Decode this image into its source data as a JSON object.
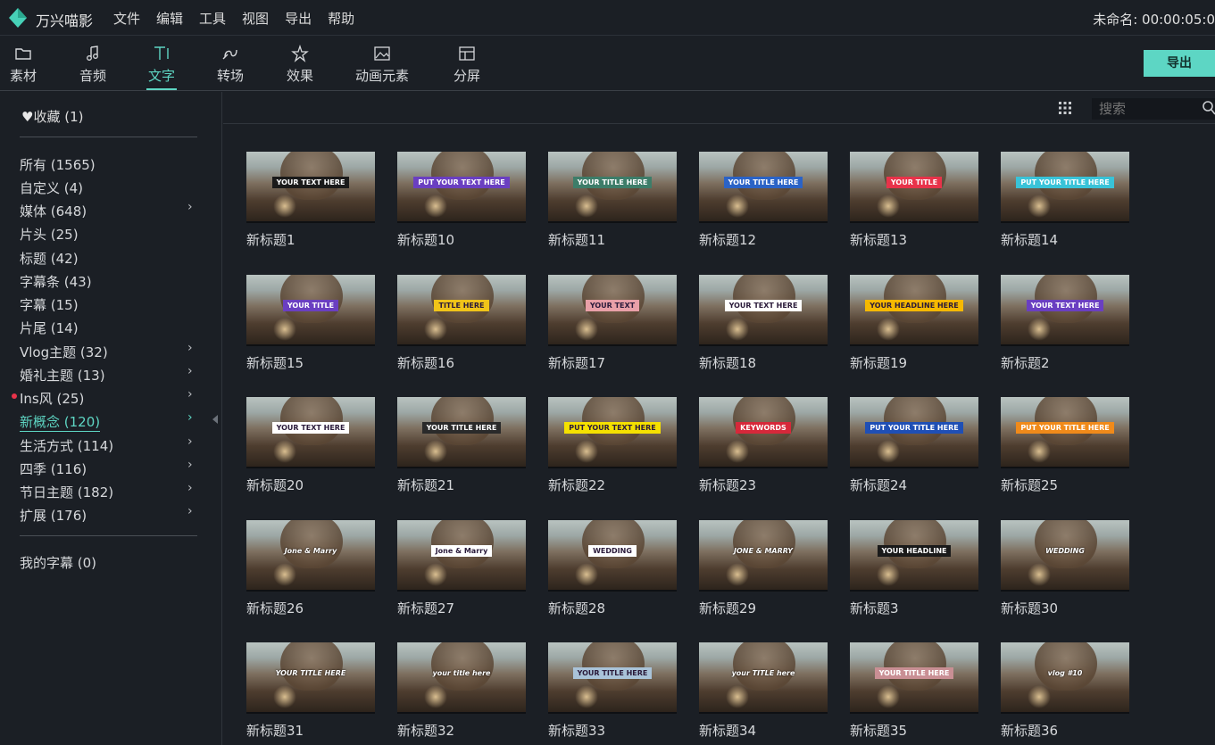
{
  "app": {
    "title": "万兴喵影",
    "project": "未命名: 00:00:05:0",
    "menu": [
      "文件",
      "编辑",
      "工具",
      "视图",
      "导出",
      "帮助"
    ]
  },
  "tabs": [
    {
      "label": "素材",
      "icon": "folder-icon"
    },
    {
      "label": "音频",
      "icon": "music-note-icon"
    },
    {
      "label": "文字",
      "icon": "text-icon",
      "active": true
    },
    {
      "label": "转场",
      "icon": "transition-icon"
    },
    {
      "label": "效果",
      "icon": "effects-icon"
    },
    {
      "label": "动画元素",
      "icon": "image-icon"
    },
    {
      "label": "分屏",
      "icon": "split-screen-icon"
    }
  ],
  "export_label": "导出",
  "sidebar": {
    "favorites": "收藏 (1)",
    "categories": [
      {
        "label": "所有 (1565)",
        "arrow": false
      },
      {
        "label": "自定义 (4)",
        "arrow": false
      },
      {
        "label": "媒体 (648)",
        "arrow": true
      },
      {
        "label": "片头 (25)",
        "arrow": false
      },
      {
        "label": "标题 (42)",
        "arrow": false
      },
      {
        "label": "字幕条 (43)",
        "arrow": false
      },
      {
        "label": "字幕 (15)",
        "arrow": false
      },
      {
        "label": "片尾 (14)",
        "arrow": false
      },
      {
        "label": "Vlog主题 (32)",
        "arrow": true
      },
      {
        "label": "婚礼主题 (13)",
        "arrow": true
      },
      {
        "label": "Ins风 (25)",
        "arrow": true,
        "dot": true
      },
      {
        "label": "新概念 (120)",
        "arrow": true,
        "active": true
      },
      {
        "label": "生活方式 (114)",
        "arrow": true
      },
      {
        "label": "四季 (116)",
        "arrow": true
      },
      {
        "label": "节日主题 (182)",
        "arrow": true
      },
      {
        "label": "扩展 (176)",
        "arrow": true
      }
    ],
    "my_subtitles": "我的字幕 (0)"
  },
  "search": {
    "placeholder": "搜索"
  },
  "colors": {
    "accent": "#5ed6c3",
    "export_bg": "#5dd6c4",
    "background": "#1b1f25"
  },
  "templates": [
    {
      "name": "新标题1",
      "overlay": "YOUR TEXT HERE",
      "color": "#1a1a1a"
    },
    {
      "name": "新标题10",
      "overlay": "PUT YOUR TEXT HERE",
      "color": "#6a3fc1"
    },
    {
      "name": "新标题11",
      "overlay": "YOUR TITLE HERE",
      "color": "#3d7d69"
    },
    {
      "name": "新标题12",
      "overlay": "YOUR TITLE HERE",
      "color": "#2b63c6"
    },
    {
      "name": "新标题13",
      "overlay": "YOUR TITLE",
      "color": "#e8334a"
    },
    {
      "name": "新标题14",
      "overlay": "PUT YOUR TITLE HERE",
      "color": "#39c3d8"
    },
    {
      "name": "新标题15",
      "overlay": "YOUR TITLE",
      "color": "#6a3fc1"
    },
    {
      "name": "新标题16",
      "overlay": "TITLE HERE",
      "color": "#f0c419"
    },
    {
      "name": "新标题17",
      "overlay": "YOUR TEXT",
      "color": "#e9a0a8"
    },
    {
      "name": "新标题18",
      "overlay": "YOUR TEXT HERE",
      "color": "#ffffff"
    },
    {
      "name": "新标题19",
      "overlay": "YOUR HEADLINE HERE",
      "color": "#f5b800"
    },
    {
      "name": "新标题2",
      "overlay": "YOUR TEXT HERE",
      "color": "#6a3fc1"
    },
    {
      "name": "新标题20",
      "overlay": "YOUR TEXT HERE",
      "color": "#ffffff"
    },
    {
      "name": "新标题21",
      "overlay": "YOUR TITLE HERE",
      "color": "#2a2a2a"
    },
    {
      "name": "新标题22",
      "overlay": "PUT YOUR TEXT HERE",
      "color": "#f5e100"
    },
    {
      "name": "新标题23",
      "overlay": "KEYWORDS",
      "color": "#d6283a"
    },
    {
      "name": "新标题24",
      "overlay": "PUT YOUR TITLE HERE",
      "color": "#1f4fb5"
    },
    {
      "name": "新标题25",
      "overlay": "PUT YOUR TITLE HERE",
      "color": "#f08a1a"
    },
    {
      "name": "新标题26",
      "overlay": "Jone & Marry",
      "color": "transparent"
    },
    {
      "name": "新标题27",
      "overlay": "Jone & Marry",
      "color": "#ffffff"
    },
    {
      "name": "新标题28",
      "overlay": "WEDDING",
      "color": "#ffffff"
    },
    {
      "name": "新标题29",
      "overlay": "JONE & MARRY",
      "color": "transparent"
    },
    {
      "name": "新标题3",
      "overlay": "YOUR HEADLINE",
      "color": "#1a1a1a"
    },
    {
      "name": "新标题30",
      "overlay": "WEDDING",
      "color": "transparent"
    },
    {
      "name": "新标题31",
      "overlay": "YOUR TITLE HERE",
      "color": "transparent"
    },
    {
      "name": "新标题32",
      "overlay": "your title here",
      "color": "transparent"
    },
    {
      "name": "新标题33",
      "overlay": "YOUR TITLE HERE",
      "color": "#a9c3d9"
    },
    {
      "name": "新标题34",
      "overlay": "your TITLE here",
      "color": "transparent"
    },
    {
      "name": "新标题35",
      "overlay": "YOUR TITLE HERE",
      "color": "#c98f94"
    },
    {
      "name": "新标题36",
      "overlay": "vlog #10",
      "color": "transparent"
    }
  ]
}
